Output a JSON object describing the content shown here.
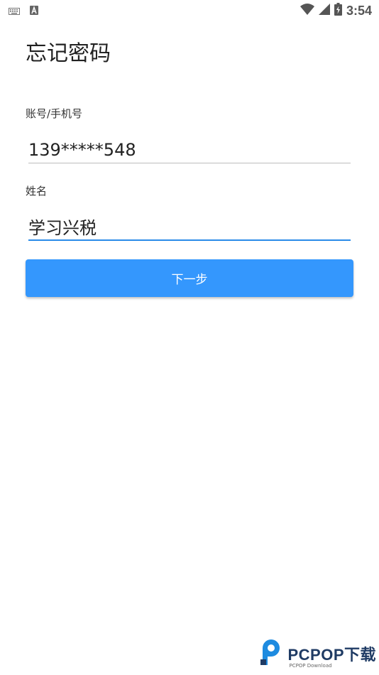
{
  "status_bar": {
    "time": "3:54",
    "icons": [
      "keyboard-icon",
      "app-a-icon",
      "wifi-icon",
      "signal-icon",
      "battery-charging-icon"
    ]
  },
  "page": {
    "title": "忘记密码"
  },
  "form": {
    "account_label": "账号/手机号",
    "account_value": "139*****548",
    "name_label": "姓名",
    "name_value": "学习兴税",
    "next_button": "下一步"
  },
  "colors": {
    "accent": "#3497fd",
    "focused_underline": "#2a8be8",
    "idle_underline": "#bdbdbd"
  },
  "watermark": {
    "main": "PCPOP下载",
    "sub": "PCPOP Download"
  }
}
